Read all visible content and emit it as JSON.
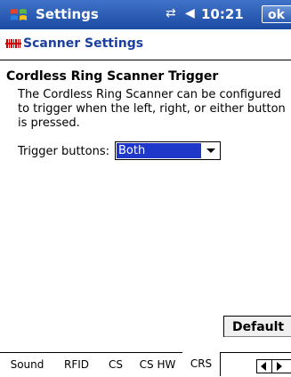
{
  "titlebar": {
    "title": "Settings",
    "time": "10:21",
    "ok_label": "ok",
    "icons": [
      "windows-start-icon",
      "connectivity-icon",
      "speaker-icon"
    ]
  },
  "header": {
    "title": "Scanner Settings",
    "icon": "scanner-settings-icon"
  },
  "section": {
    "title": "Cordless Ring Scanner Trigger",
    "description": "The Cordless Ring Scanner can be configured to trigger when the left, right, or either button is pressed."
  },
  "trigger": {
    "label": "Trigger buttons:",
    "selected": "Both"
  },
  "default_button": "Default",
  "tabs": [
    {
      "label": "Sound"
    },
    {
      "label": "RFID"
    },
    {
      "label": "CS"
    },
    {
      "label": "CS HW"
    },
    {
      "label": "CRS"
    }
  ],
  "active_tab": "CRS",
  "colors": {
    "titlebar": "#2a5bb5",
    "header_text": "#1b3f9e",
    "selection": "#1f38c9"
  }
}
